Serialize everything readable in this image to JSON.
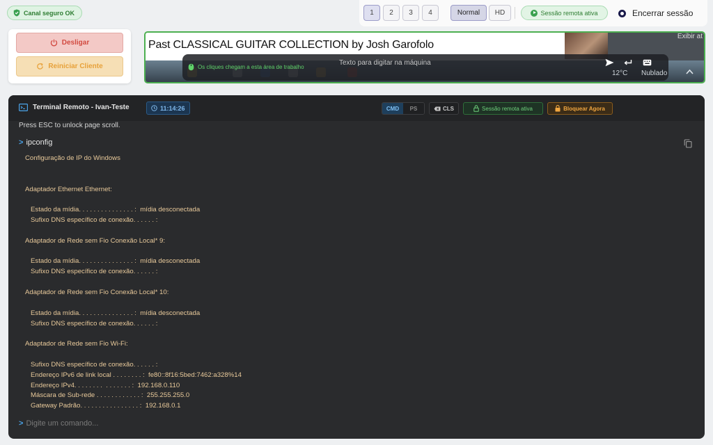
{
  "topbar": {
    "secure_label": "Canal seguro OK",
    "monitors": [
      "1",
      "2",
      "3",
      "4"
    ],
    "active_monitor": "1",
    "quality_normal": "Normal",
    "quality_hd": "HD",
    "active_quality": "Normal",
    "remote_status": "Sessão remota ativa",
    "end_session": "Encerrar sessão"
  },
  "controls": {
    "shutdown_label": "Desligar",
    "restart_label": "Reiniciar Cliente"
  },
  "remote_screen": {
    "video_title": "Past CLASSICAL GUITAR COLLECTION by Josh Garofolo",
    "side_text": "Exibir at",
    "overlay_hint": "Os cliques chegam a esta área de trabalho",
    "type_placeholder": "Texto para digitar na máquina",
    "tray_temp": "12°C",
    "tray_weather": "Nublado"
  },
  "terminal": {
    "title": "Terminal Remoto - Ivan-Teste",
    "clock": "11:14:26",
    "mode_cmd": "CMD",
    "mode_ps": "PS",
    "active_mode": "CMD",
    "cls_label": "CLS",
    "session_badge": "Sessão remota ativa",
    "lock_label": "Bloquear Agora",
    "esc_note": "Press ESC to unlock page scroll.",
    "command": "ipconfig",
    "output": [
      "Configuração de IP do Windows",
      "",
      "",
      "Adaptador Ethernet Ethernet:",
      "",
      "   Estado da mídia. . . . . . . . . . . . . . . :  mídia desconectada",
      "   Sufixo DNS específico de conexão. . . . . . :",
      "",
      "Adaptador de Rede sem Fio Conexão Local* 9:",
      "",
      "   Estado da mídia. . . . . . . . . . . . . . . :  mídia desconectada",
      "   Sufixo DNS específico de conexão. . . . . . :",
      "",
      "Adaptador de Rede sem Fio Conexão Local* 10:",
      "",
      "   Estado da mídia. . . . . . . . . . . . . . . :  mídia desconectada",
      "   Sufixo DNS específico de conexão. . . . . . :",
      "",
      "Adaptador de Rede sem Fio Wi-Fi:",
      "",
      "   Sufixo DNS específico de conexão. . . . . . :",
      "   Endereço IPv6 de link local . . . . . . . . :  fe80::8f16:5bed:7462:a328%14",
      "   Endereço IPv4. . . . . . . .  . . . . . . . :  192.168.0.110",
      "   Máscara de Sub-rede . . . . . . . . . . . . :  255.255.255.0",
      "   Gateway Padrão. . . . . . . . . . . . . . . . :  192.168.0.1"
    ],
    "input_placeholder": "Digite um comando..."
  },
  "colors": {
    "accent_green": "#4caf50",
    "terminal_bg": "#2a2b2d",
    "output_text": "#e8c99a",
    "danger": "#d24a40",
    "warning": "#e7a13a"
  }
}
